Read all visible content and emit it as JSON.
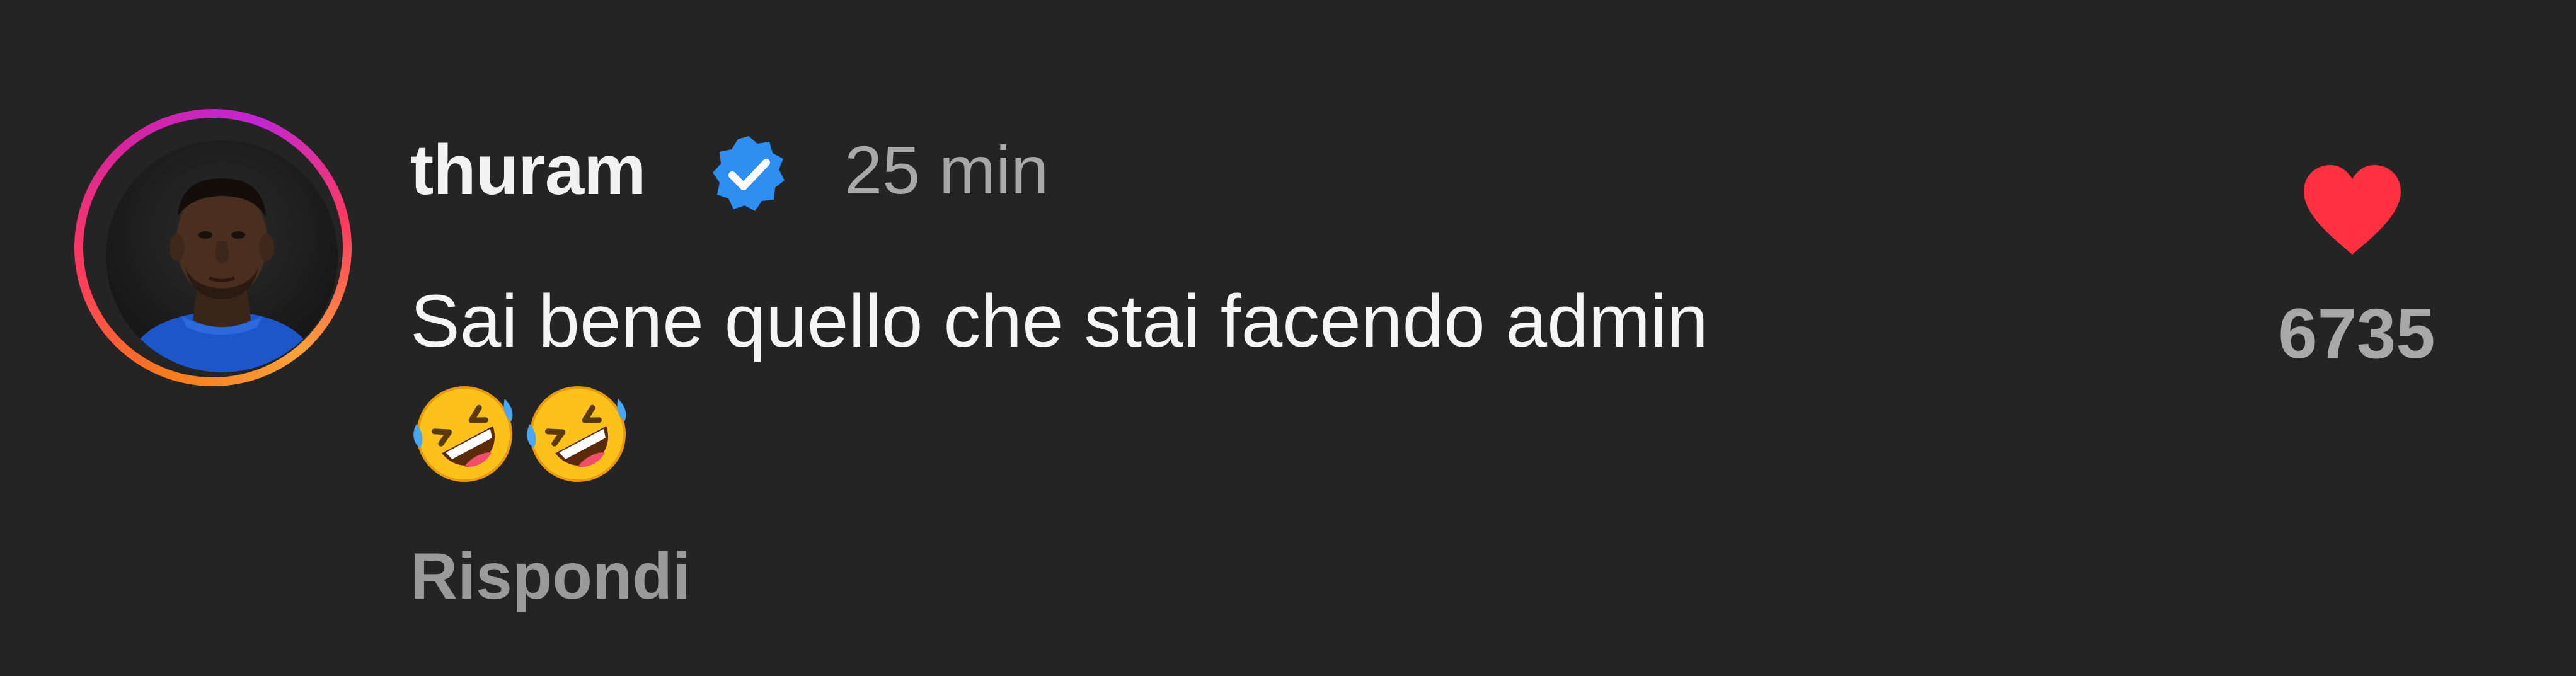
{
  "comment": {
    "username": "thuram",
    "timestamp": "25 min",
    "text": "Sai bene quello che stai facendo admin",
    "emojis": [
      "rolling-on-floor-laughing-emoji",
      "rolling-on-floor-laughing-emoji"
    ],
    "reply_label": "Rispondi",
    "like_count": "6735",
    "verified": true
  },
  "icons": {
    "verified": "verified-badge-icon",
    "like": "heart-icon"
  },
  "colors": {
    "background": "#242424",
    "verified_blue": "#2f8ff0",
    "heart_red": "#ff3040",
    "text_primary": "#f2f2f2",
    "text_secondary": "#a8a8a8"
  }
}
